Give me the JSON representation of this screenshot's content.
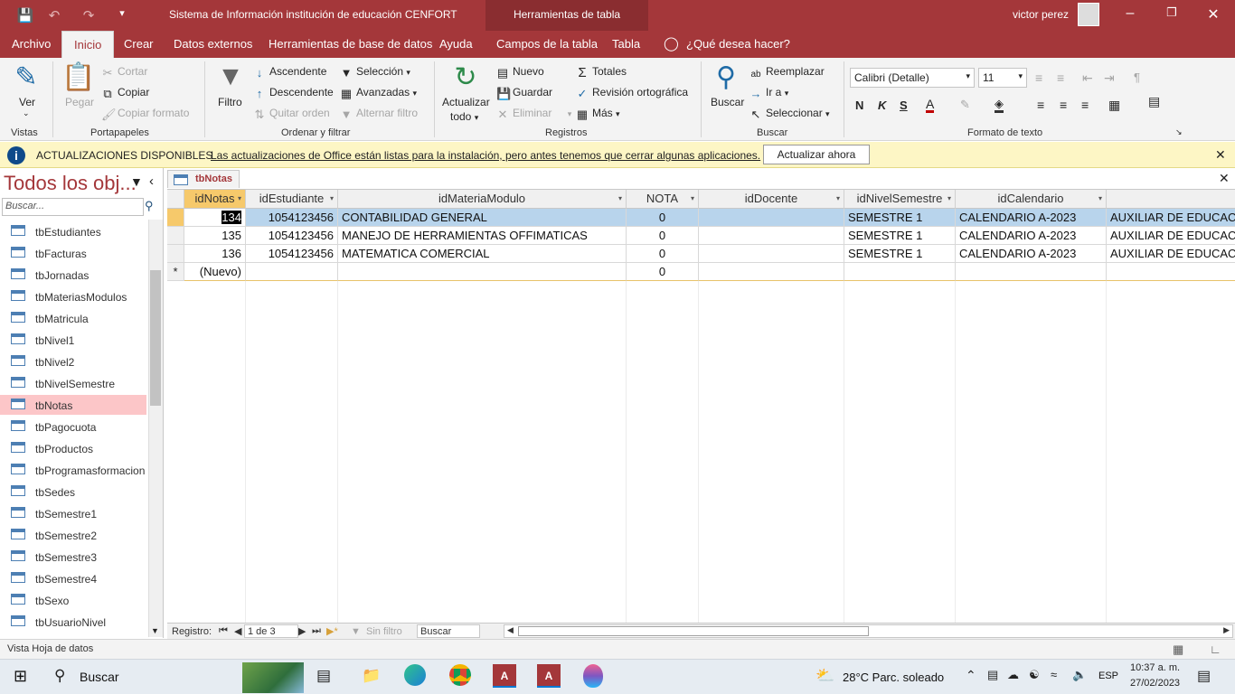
{
  "titlebar": {
    "title": "Sistema de Información institución de educación CENFORT",
    "context_tab": "Herramientas de tabla",
    "user": "victor perez"
  },
  "tabs": [
    "Archivo",
    "Inicio",
    "Crear",
    "Datos externos",
    "Herramientas de base de datos",
    "Ayuda",
    "Campos de la tabla",
    "Tabla"
  ],
  "tell_me": "¿Qué desea hacer?",
  "ribbon": {
    "vistas": {
      "ver": "Ver",
      "group": "Vistas"
    },
    "portapapeles": {
      "pegar": "Pegar",
      "cortar": "Cortar",
      "copiar": "Copiar",
      "copiar_formato": "Copiar formato",
      "group": "Portapapeles"
    },
    "ordenar": {
      "filtro": "Filtro",
      "ascendente": "Ascendente",
      "descendente": "Descendente",
      "quitar_orden": "Quitar orden",
      "seleccion": "Selección",
      "avanzadas": "Avanzadas",
      "alternar_filtro": "Alternar filtro",
      "group": "Ordenar y filtrar"
    },
    "registros": {
      "actualizar": "Actualizar",
      "todo": "todo",
      "nuevo": "Nuevo",
      "guardar": "Guardar",
      "eliminar": "Eliminar",
      "totales": "Totales",
      "revision": "Revisión ortográfica",
      "mas": "Más",
      "group": "Registros"
    },
    "buscar": {
      "buscar": "Buscar",
      "reemplazar": "Reemplazar",
      "ir_a": "Ir a",
      "seleccionar": "Seleccionar",
      "group": "Buscar"
    },
    "formato": {
      "font": "Calibri (Detalle)",
      "size": "11",
      "bold": "N",
      "italic": "K",
      "underline": "S",
      "group": "Formato de texto"
    }
  },
  "message_bar": {
    "title": "ACTUALIZACIONES DISPONIBLES",
    "text": "Las actualizaciones de Office están listas para la instalación, pero antes tenemos que cerrar algunas aplicaciones.",
    "button": "Actualizar ahora"
  },
  "nav": {
    "header": "Todos los obj...",
    "search_placeholder": "Buscar...",
    "items": [
      "tbEstudiantes",
      "tbFacturas",
      "tbJornadas",
      "tbMateriasModulos",
      "tbMatricula",
      "tbNivel1",
      "tbNivel2",
      "tbNivelSemestre",
      "tbNotas",
      "tbPagocuota",
      "tbProductos",
      "tbProgramasformacion",
      "tbSedes",
      "tbSemestre1",
      "tbSemestre2",
      "tbSemestre3",
      "tbSemestre4",
      "tbSexo",
      "tbUsuarioNivel"
    ],
    "selected": "tbNotas"
  },
  "document": {
    "tab": "tbNotas",
    "columns": [
      "idNotas",
      "idEstudiante",
      "idMateriaModulo",
      "NOTA",
      "idDocente",
      "idNivelSemestre",
      "idCalendario",
      ""
    ],
    "rows": [
      [
        "134",
        "1054123456",
        "CONTABILIDAD GENERAL",
        "0",
        "",
        "SEMESTRE 1",
        "CALENDARIO A-2023",
        "AUXILIAR DE EDUCACIO"
      ],
      [
        "135",
        "1054123456",
        "MANEJO DE HERRAMIENTAS OFFIMATICAS",
        "0",
        "",
        "SEMESTRE 1",
        "CALENDARIO A-2023",
        "AUXILIAR DE EDUCACIO"
      ],
      [
        "136",
        "1054123456",
        "MATEMATICA COMERCIAL",
        "0",
        "",
        "SEMESTRE 1",
        "CALENDARIO A-2023",
        "AUXILIAR DE EDUCACIO"
      ]
    ],
    "new_row_label": "(Nuevo)",
    "new_row_nota": "0"
  },
  "record_nav": {
    "label": "Registro:",
    "position": "1 de 3",
    "filter": "Sin filtro",
    "search": "Buscar"
  },
  "status": {
    "text": "Vista Hoja de datos"
  },
  "taskbar": {
    "search": "Buscar",
    "weather": "28°C  Parc. soleado",
    "lang": "ESP",
    "time": "10:37 a. m.",
    "date": "27/02/2023"
  },
  "colors": {
    "accent": "#a4373a",
    "selection": "#b8d4ec",
    "nav_selected": "#fcc6c8",
    "message_bar": "#fdf6c5"
  }
}
